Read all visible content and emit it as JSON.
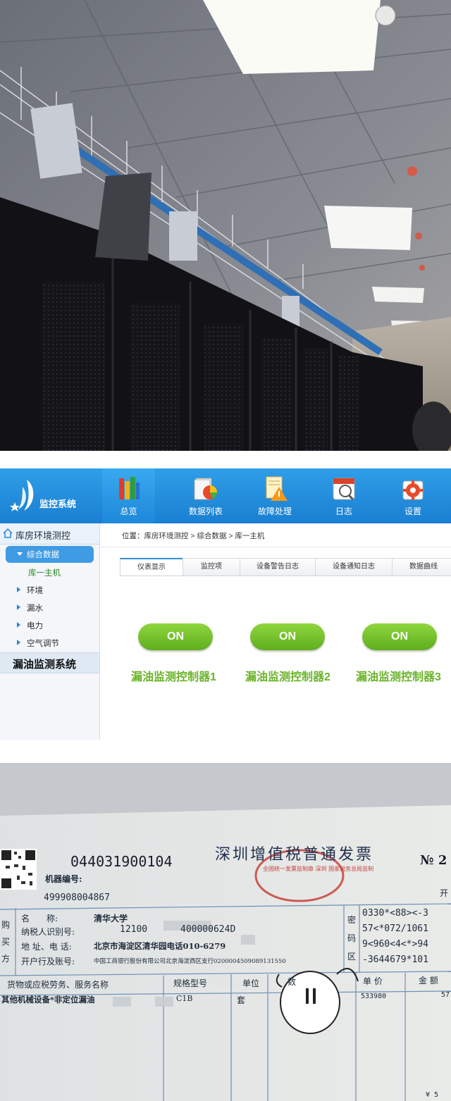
{
  "monitor": {
    "brand_title": "监控系统",
    "nav": [
      {
        "label": "总览",
        "icon": "overview-books-icon",
        "active": true
      },
      {
        "label": "数据列表",
        "icon": "data-list-chart-icon",
        "active": false
      },
      {
        "label": "故障处理",
        "icon": "fault-warning-icon",
        "active": false
      },
      {
        "label": "日志",
        "icon": "calendar-log-icon",
        "active": false
      },
      {
        "label": "设置",
        "icon": "settings-gear-icon",
        "active": false
      }
    ],
    "sidebar": {
      "header": "库房环境测控",
      "selected_group": "综合数据",
      "selected_child": "库一主机",
      "items": [
        "环境",
        "漏水",
        "电力",
        "空气调节"
      ],
      "section": "漏油监测系统"
    },
    "breadcrumb": "位置：库房环境测控 > 综合数据 > 库一主机",
    "tabs": [
      "仪表显示",
      "监控项",
      "设备警告日志",
      "设备通知日志",
      "数据曲线"
    ],
    "controllers": [
      {
        "state": "ON",
        "label": "漏油监测控制器1"
      },
      {
        "state": "ON",
        "label": "漏油监测控制器2"
      },
      {
        "state": "ON",
        "label": "漏油监测控制器3"
      }
    ],
    "colors": {
      "topbar": "#1a7fd1",
      "on_green": "#6bb32a"
    }
  },
  "invoice": {
    "code": "044031900104",
    "title": "深圳增值税普通发票",
    "no_label": "№ 2",
    "seal_text": "全国统一发票监制章 深圳 国家税务总局监制",
    "machine_label": "机器编号:",
    "machine_no": "499908004867",
    "right_edge": "开",
    "buyer_side": "购 买 方",
    "name_label": "名　　称:",
    "name_value": "清华大学",
    "taxid_label": "纳税人识别号:",
    "taxid_value": "12100",
    "taxid_tail": "400000624D",
    "addr_label": "地 址、电 话:",
    "addr_value": "北京市海淀区清华园电话010-6279",
    "bank_label": "开户行及账号:",
    "bank_value": "中国工商银行股份有限公司北京海淀西区支行0200004509089131550",
    "code_side": "密 码 区",
    "cipher": [
      "0330*<88><-3",
      "57<*072/1061",
      "9<960<4<*>94",
      "-3644679*101"
    ],
    "col_goods": "货物或应税劳务、服务名称",
    "col_spec": "规格型号",
    "col_unit": "单位",
    "col_qty": "数",
    "col_price": "单 价",
    "col_amount": "金 额",
    "row_goods": "其他机械设备*非定位漏油",
    "row_spec": "C1B",
    "row_unit": "套",
    "row_price": "533980",
    "row_amount": "57",
    "bottom_mark": "¥ 5"
  }
}
